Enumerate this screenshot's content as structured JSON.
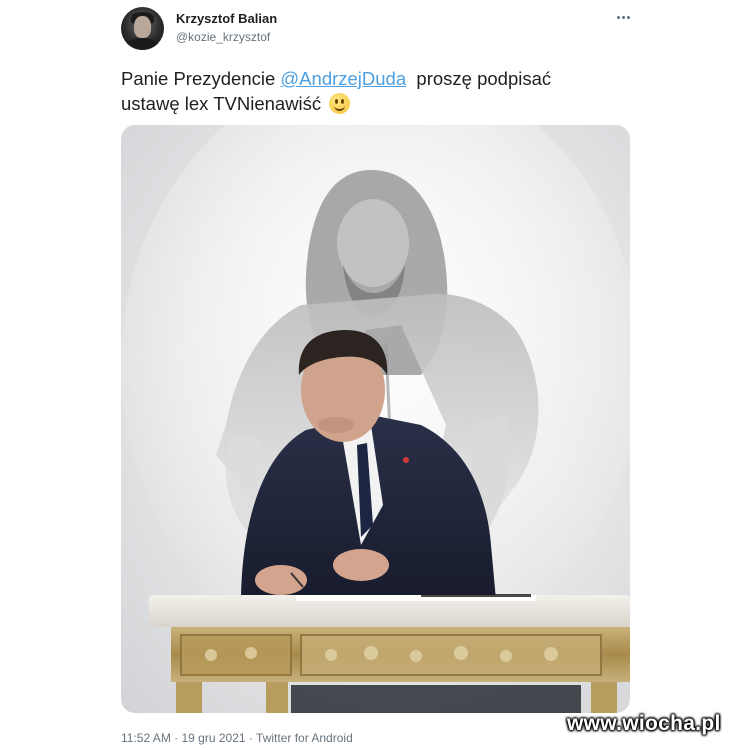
{
  "tweet": {
    "author": {
      "display_name": "Krzysztof Balian",
      "handle": "@kozie_krzysztof"
    },
    "more_icon": "more-horizontal-icon",
    "text": {
      "part1": "Panie Prezydencie ",
      "mention": "@AndrzejDuda",
      "part2": "  proszę podpisać",
      "part3": "ustawę lex TVNienawiść"
    },
    "emoji": "slightly-smiling-face-emoji",
    "meta": {
      "time": "11:52 AM",
      "date": "19 gru 2021",
      "source": "Twitter for Android",
      "separator": "·"
    }
  },
  "watermark": "www.wiocha.pl",
  "colors": {
    "mention": "#4d9fe0",
    "secondary_text": "#66737f",
    "primary_text": "#1f1f1f"
  }
}
